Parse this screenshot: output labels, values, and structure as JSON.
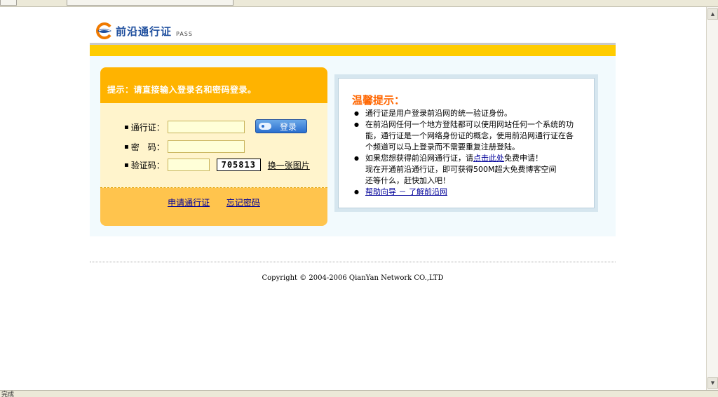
{
  "status": {
    "text": "完成"
  },
  "logo": {
    "title": "前沿通行证",
    "pass": "PASS"
  },
  "login": {
    "hint": "提示：请直接输入登录名和密码登录。",
    "pass_label": "通行证：",
    "password_label": "密　码：",
    "captcha_label": "验证码：",
    "login_button": "登录",
    "captcha_value": "705813",
    "change_image": "换一张图片",
    "apply_link": "申请通行证",
    "forgot_link": "忘记密码"
  },
  "tips": {
    "title": "温馨提示：",
    "item1": "通行证是用户登录前沿网的统一验证身份。",
    "item2": "在前沿网任何一个地方登陆都可以使用网站任何一个系统的功能，通行证是一个网络身份证的概念，使用前沿网通行证在各个频道可以马上登录而不需要重复注册登陆。",
    "item3_before": "如果您想获得前沿网通行证，请",
    "item3_link": "点击此处",
    "item3_after": "免费申请！",
    "item3_line2": "现在开通前沿通行证，即可获得500M超大免费博客空间",
    "item3_line3": "还等什么，赶快加入吧！",
    "item4_link": "帮助向导 － 了解前沿网"
  },
  "footer": {
    "copyright": "Copyright © 2004-2006 QianYan Network CO.,LTD"
  },
  "colors": {
    "brand_blue": "#1f4f9e",
    "accent_yellow": "#ffcc00",
    "panel_orange": "#ffb300",
    "tips_orange": "#ff6600"
  }
}
